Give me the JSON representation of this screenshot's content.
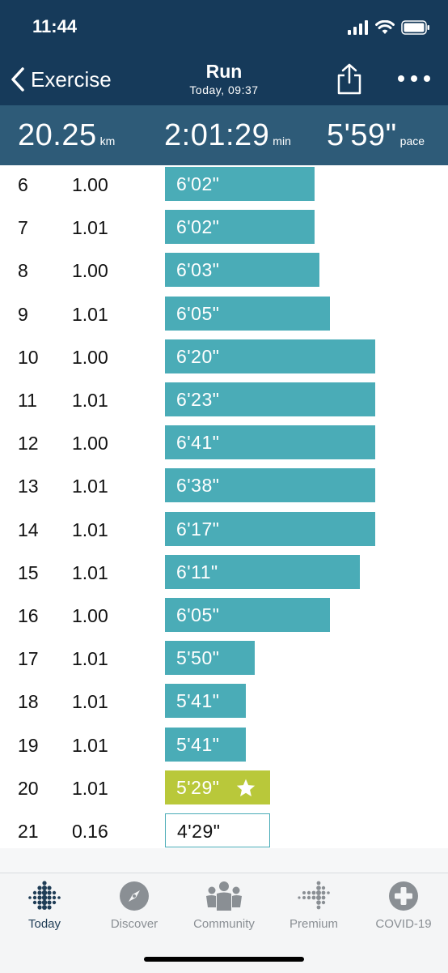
{
  "status_bar": {
    "time": "11:44"
  },
  "nav": {
    "back_label": "Exercise",
    "title": "Run",
    "subtitle": "Today, 09:37"
  },
  "summary": {
    "distance": "20.25",
    "distance_unit": "km",
    "duration": "2:01:29",
    "duration_unit": "min",
    "pace": "5'59\"",
    "pace_unit": "pace"
  },
  "splits": [
    {
      "km": "6",
      "distance": "1.00",
      "pace": "6'02\"",
      "pace_seconds": 362,
      "state": "normal"
    },
    {
      "km": "7",
      "distance": "1.01",
      "pace": "6'02\"",
      "pace_seconds": 362,
      "state": "normal"
    },
    {
      "km": "8",
      "distance": "1.00",
      "pace": "6'03\"",
      "pace_seconds": 363,
      "state": "normal"
    },
    {
      "km": "9",
      "distance": "1.01",
      "pace": "6'05\"",
      "pace_seconds": 365,
      "state": "normal"
    },
    {
      "km": "10",
      "distance": "1.00",
      "pace": "6'20\"",
      "pace_seconds": 380,
      "state": "normal"
    },
    {
      "km": "11",
      "distance": "1.01",
      "pace": "6'23\"",
      "pace_seconds": 383,
      "state": "normal"
    },
    {
      "km": "12",
      "distance": "1.00",
      "pace": "6'41\"",
      "pace_seconds": 401,
      "state": "normal"
    },
    {
      "km": "13",
      "distance": "1.01",
      "pace": "6'38\"",
      "pace_seconds": 398,
      "state": "normal"
    },
    {
      "km": "14",
      "distance": "1.01",
      "pace": "6'17\"",
      "pace_seconds": 377,
      "state": "normal"
    },
    {
      "km": "15",
      "distance": "1.01",
      "pace": "6'11\"",
      "pace_seconds": 371,
      "state": "normal"
    },
    {
      "km": "16",
      "distance": "1.00",
      "pace": "6'05\"",
      "pace_seconds": 365,
      "state": "normal"
    },
    {
      "km": "17",
      "distance": "1.01",
      "pace": "5'50\"",
      "pace_seconds": 350,
      "state": "normal"
    },
    {
      "km": "18",
      "distance": "1.01",
      "pace": "5'41\"",
      "pace_seconds": 341,
      "state": "normal"
    },
    {
      "km": "19",
      "distance": "1.01",
      "pace": "5'41\"",
      "pace_seconds": 341,
      "state": "normal"
    },
    {
      "km": "20",
      "distance": "1.01",
      "pace": "5'29\"",
      "pace_seconds": 329,
      "state": "best"
    },
    {
      "km": "21",
      "distance": "0.16",
      "pace": "4'29\"",
      "pace_seconds": 329,
      "state": "partial"
    }
  ],
  "tabs": [
    {
      "label": "Today",
      "icon": "fitbit-dots-icon",
      "active": true
    },
    {
      "label": "Discover",
      "icon": "compass-icon",
      "active": false
    },
    {
      "label": "Community",
      "icon": "community-icon",
      "active": false
    },
    {
      "label": "Premium",
      "icon": "premium-dots-icon",
      "active": false
    },
    {
      "label": "COVID-19",
      "icon": "plus-circle-icon",
      "active": false
    }
  ],
  "colors": {
    "header_bg": "#163a5a",
    "stats_bg": "#2e5b78",
    "bar": "#4aacb7",
    "best_bar": "#b9c83a",
    "tab_active": "#1f3d56",
    "tab_inactive": "#8a8f94"
  }
}
